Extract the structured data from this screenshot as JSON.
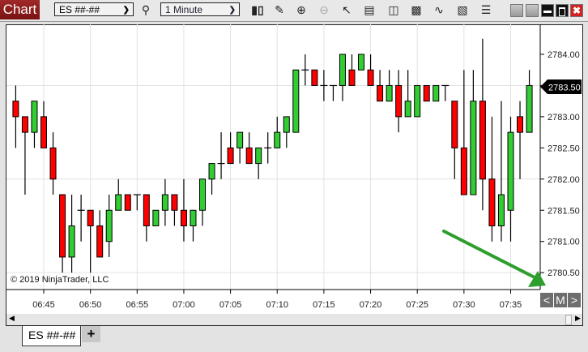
{
  "toolbar": {
    "chart_label": "Chart",
    "instrument": "ES ##-##",
    "timeframe": "1 Minute",
    "icons": [
      "search-icon",
      "bar-type-icon",
      "drawing-tool-icon",
      "zoom-in-icon",
      "zoom-out-icon",
      "pointer-icon",
      "data-box-icon",
      "chart-trader-icon",
      "indicators-icon",
      "strategies-icon",
      "templates-icon",
      "properties-icon"
    ],
    "window_buttons": [
      "link-gray-1",
      "link-gray-2",
      "minimize",
      "maximize",
      "close"
    ]
  },
  "chart": {
    "copyright": "© 2019 NinjaTrader, LLC",
    "price_labels": [
      "2784.00",
      "2783.50",
      "2783.00",
      "2782.50",
      "2782.00",
      "2781.50",
      "2781.00",
      "2780.50"
    ],
    "last_price": "2783.50",
    "time_labels": [
      "06:45",
      "06:50",
      "06:55",
      "07:00",
      "07:05",
      "07:10",
      "07:15",
      "07:20",
      "07:25",
      "07:30",
      "07:35"
    ],
    "nav": {
      "prev": "<",
      "middle": "M",
      "next": ">"
    },
    "colors": {
      "up": "#32cd32",
      "down": "#ff0000",
      "outline": "#000000",
      "annotation_arrow": "#2e9e2e"
    }
  },
  "chart_data": {
    "type": "candlestick",
    "xlabel": "",
    "ylabel": "",
    "ylim": [
      2780.5,
      2784.25
    ],
    "grid": true,
    "candles": [
      [
        "06:42",
        2783.25,
        2783.5,
        2782.5,
        2783.0
      ],
      [
        "06:43",
        2783.0,
        2783.0,
        2781.75,
        2782.75
      ],
      [
        "06:44",
        2782.75,
        2783.25,
        2782.5,
        2783.25
      ],
      [
        "06:45",
        2783.0,
        2783.25,
        2782.5,
        2782.5
      ],
      [
        "06:46",
        2782.5,
        2782.75,
        2781.75,
        2782.0
      ],
      [
        "06:47",
        2781.75,
        2781.75,
        2780.5,
        2780.75
      ],
      [
        "06:48",
        2780.75,
        2781.75,
        2780.5,
        2781.25
      ],
      [
        "06:49",
        2781.5,
        2781.75,
        2781.0,
        2781.5
      ],
      [
        "06:50",
        2781.5,
        2781.5,
        2780.5,
        2781.25
      ],
      [
        "06:51",
        2781.25,
        2781.5,
        2780.75,
        2780.75
      ],
      [
        "06:52",
        2781.0,
        2781.75,
        2780.75,
        2781.5
      ],
      [
        "06:53",
        2781.5,
        2782.0,
        2781.5,
        2781.75
      ],
      [
        "06:54",
        2781.75,
        2781.75,
        2781.5,
        2781.5
      ],
      [
        "06:55",
        2781.75,
        2781.75,
        2781.5,
        2781.75
      ],
      [
        "06:56",
        2781.75,
        2781.75,
        2781.0,
        2781.25
      ],
      [
        "06:57",
        2781.25,
        2781.5,
        2781.25,
        2781.5
      ],
      [
        "06:58",
        2781.5,
        2782.0,
        2781.25,
        2781.75
      ],
      [
        "06:59",
        2781.75,
        2781.75,
        2781.25,
        2781.5
      ],
      [
        "07:00",
        2781.5,
        2782.0,
        2781.0,
        2781.25
      ],
      [
        "07:01",
        2781.25,
        2781.5,
        2781.0,
        2781.5
      ],
      [
        "07:02",
        2781.5,
        2782.0,
        2781.25,
        2782.0
      ],
      [
        "07:03",
        2782.0,
        2782.25,
        2781.75,
        2782.25
      ],
      [
        "07:04",
        2782.25,
        2782.75,
        2782.0,
        2782.25
      ],
      [
        "07:05",
        2782.5,
        2782.75,
        2782.25,
        2782.25
      ],
      [
        "07:06",
        2782.5,
        2782.75,
        2782.25,
        2782.75
      ],
      [
        "07:07",
        2782.5,
        2782.75,
        2782.25,
        2782.25
      ],
      [
        "07:08",
        2782.25,
        2782.5,
        2782.0,
        2782.5
      ],
      [
        "07:09",
        2782.5,
        2782.75,
        2782.25,
        2782.5
      ],
      [
        "07:10",
        2782.5,
        2783.0,
        2782.5,
        2782.75
      ],
      [
        "07:11",
        2782.75,
        2783.0,
        2782.5,
        2783.0
      ],
      [
        "07:12",
        2782.75,
        2783.75,
        2782.75,
        2783.75
      ],
      [
        "07:13",
        2783.75,
        2784.0,
        2783.5,
        2783.75
      ],
      [
        "07:14",
        2783.75,
        2783.75,
        2783.5,
        2783.5
      ],
      [
        "07:15",
        2783.5,
        2783.75,
        2783.25,
        2783.5
      ],
      [
        "07:16",
        2783.5,
        2783.5,
        2783.25,
        2783.5
      ],
      [
        "07:17",
        2783.5,
        2784.0,
        2783.25,
        2784.0
      ],
      [
        "07:18",
        2783.75,
        2784.0,
        2783.5,
        2783.5
      ],
      [
        "07:19",
        2783.75,
        2784.0,
        2783.75,
        2784.0
      ],
      [
        "07:20",
        2783.75,
        2784.0,
        2783.5,
        2783.5
      ],
      [
        "07:21",
        2783.5,
        2783.75,
        2783.25,
        2783.25
      ],
      [
        "07:22",
        2783.25,
        2783.75,
        2783.25,
        2783.5
      ],
      [
        "07:23",
        2783.5,
        2783.75,
        2782.75,
        2783.0
      ],
      [
        "07:24",
        2783.0,
        2783.75,
        2783.0,
        2783.25
      ],
      [
        "07:25",
        2783.0,
        2783.5,
        2783.0,
        2783.5
      ],
      [
        "07:26",
        2783.5,
        2783.5,
        2783.25,
        2783.25
      ],
      [
        "07:27",
        2783.25,
        2783.5,
        2783.25,
        2783.5
      ],
      [
        "07:28",
        2783.5,
        2783.5,
        2783.25,
        2783.5
      ],
      [
        "07:29",
        2783.25,
        2783.25,
        2782.0,
        2782.5
      ],
      [
        "07:30",
        2782.5,
        2783.75,
        2781.75,
        2781.75
      ],
      [
        "07:31",
        2781.75,
        2783.75,
        2781.75,
        2783.25
      ],
      [
        "07:32",
        2783.25,
        2784.25,
        2781.5,
        2782.0
      ],
      [
        "07:33",
        2782.0,
        2783.0,
        2781.0,
        2781.25
      ],
      [
        "07:34",
        2781.25,
        2783.25,
        2781.0,
        2781.75
      ],
      [
        "07:35",
        2781.5,
        2783.0,
        2781.0,
        2782.75
      ],
      [
        "07:36",
        2783.0,
        2783.25,
        2782.0,
        2782.75
      ],
      [
        "07:37",
        2782.75,
        2783.75,
        2782.75,
        2783.5
      ]
    ]
  }
}
